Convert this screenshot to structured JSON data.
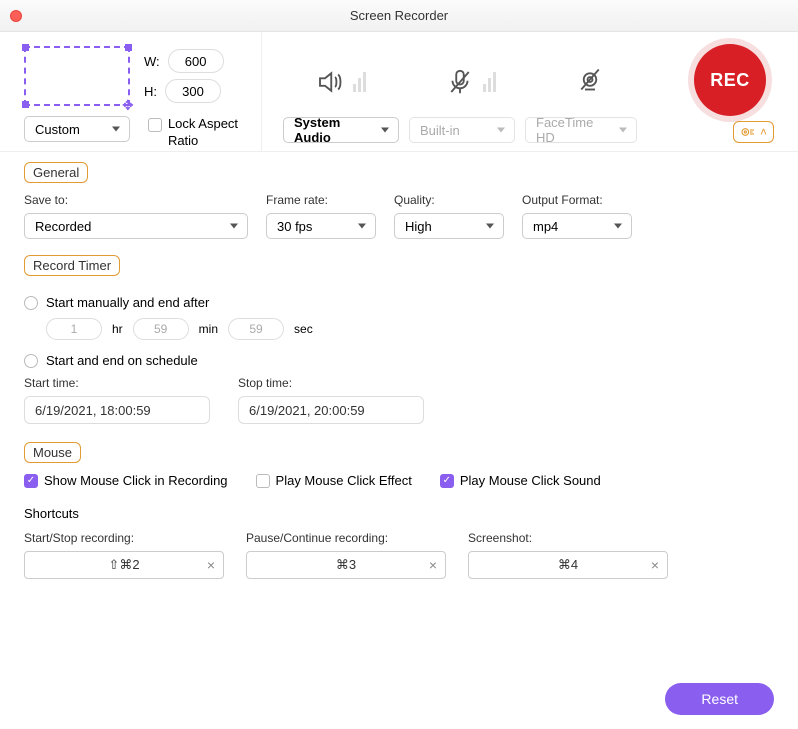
{
  "window": {
    "title": "Screen Recorder"
  },
  "region": {
    "w_label": "W:",
    "h_label": "H:",
    "w": "600",
    "h": "300",
    "preset": "Custom",
    "lock_aspect": "Lock Aspect Ratio"
  },
  "audio": {
    "system": "System Audio",
    "mic": "Built-in",
    "camera": "FaceTime HD"
  },
  "rec": {
    "label": "REC"
  },
  "sections": {
    "general": "General",
    "timer": "Record Timer",
    "mouse": "Mouse",
    "shortcuts": "Shortcuts"
  },
  "general": {
    "save_to_label": "Save to:",
    "save_to": "Recorded",
    "frame_rate_label": "Frame rate:",
    "frame_rate": "30 fps",
    "quality_label": "Quality:",
    "quality": "High",
    "format_label": "Output Format:",
    "format": "mp4"
  },
  "timer": {
    "manual_label": "Start manually and end after",
    "h": "1",
    "h_label": "hr",
    "m": "59",
    "m_label": "min",
    "s": "59",
    "s_label": "sec",
    "schedule_label": "Start and end on schedule",
    "start_label": "Start time:",
    "start": "6/19/2021, 18:00:59",
    "stop_label": "Stop time:",
    "stop": "6/19/2021, 20:00:59"
  },
  "mouse": {
    "show_click": "Show Mouse Click in Recording",
    "play_effect": "Play Mouse Click Effect",
    "play_sound": "Play Mouse Click Sound"
  },
  "shortcuts": {
    "startstop_label": "Start/Stop recording:",
    "startstop": "⇧⌘2",
    "pause_label": "Pause/Continue recording:",
    "pause": "⌘3",
    "screenshot_label": "Screenshot:",
    "screenshot": "⌘4"
  },
  "footer": {
    "reset": "Reset"
  }
}
